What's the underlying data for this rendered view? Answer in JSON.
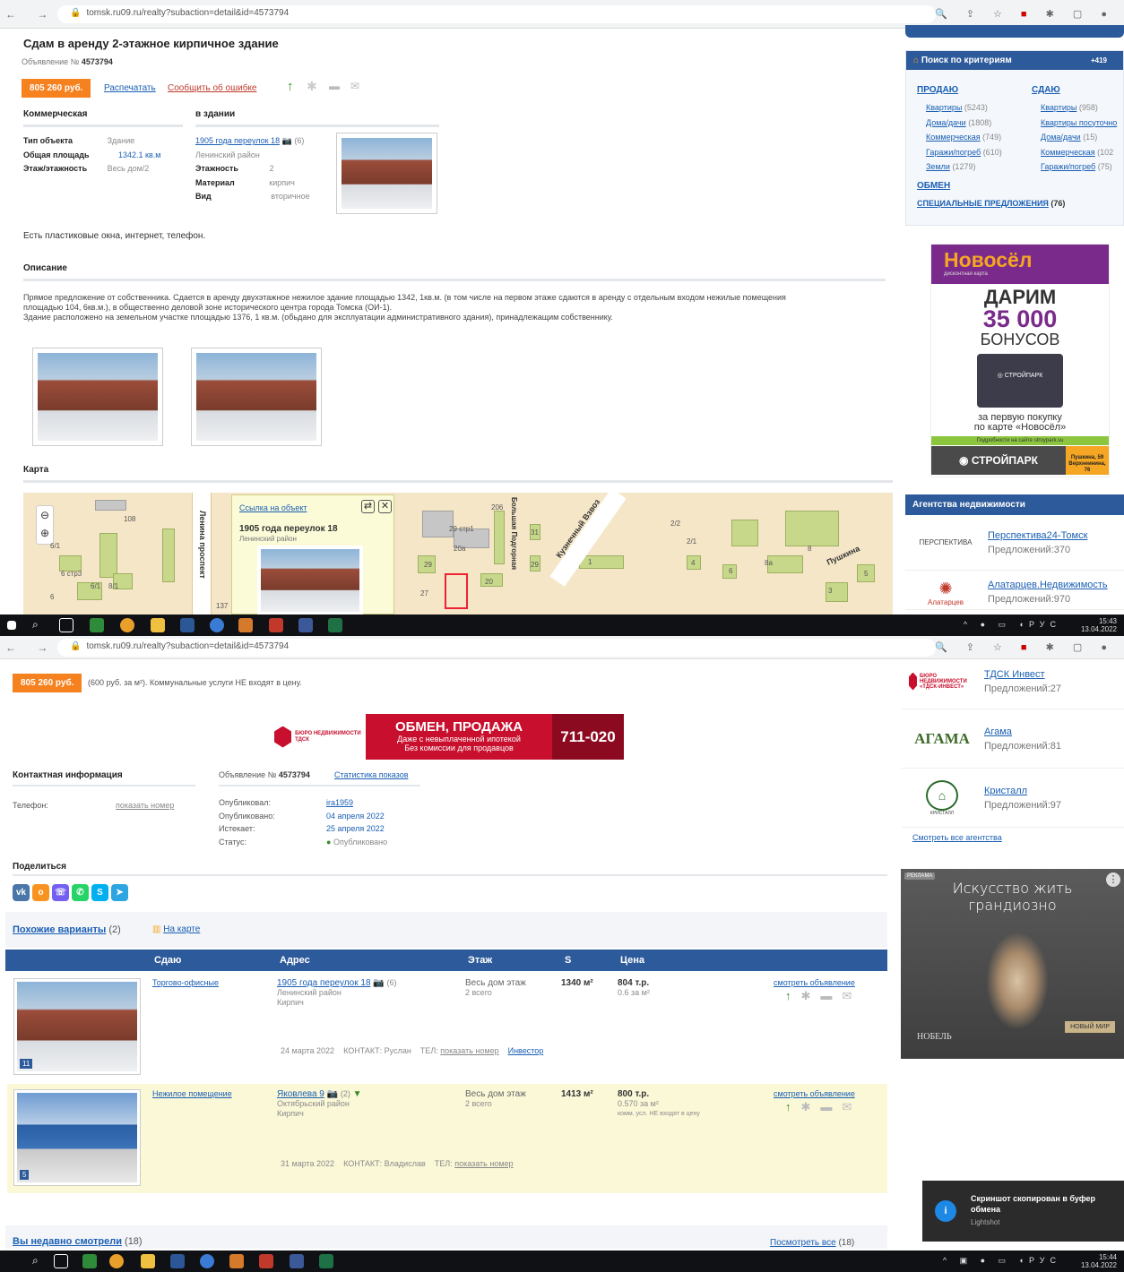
{
  "browser": {
    "url_top": "tomsk.ru09.ru/realty?subaction=detail&id=4573794",
    "url_bottom": "tomsk.ru09.ru/realty?subaction=detail&id=4573794",
    "nav": "← → C"
  },
  "listing": {
    "title": "Сдам в аренду 2-этажное кирпичное здание",
    "ad_number_label": "Объявление №",
    "ad_number": "4573794",
    "price": "805 260 руб.",
    "print": "Распечатать",
    "report": "Сообщить об ошибке",
    "section_commercial": "Коммерческая",
    "section_building": "в здании",
    "type_label": "Тип объекта",
    "type_value": "Здание",
    "area_label": "Общая площадь",
    "area_value": "1342.1 кв.м",
    "floor_label": "Этаж/этажность",
    "floor_value": "Весь дом/2",
    "address": "1905 года переулок 18",
    "address_count": "(6)",
    "district": "Ленинский район",
    "floors_label": "Этажность",
    "floors_value": "2",
    "material_label": "Материал",
    "material_value": "кирпич",
    "view_label": "Вид",
    "view_value": "вторичное",
    "features": "Есть пластиковые окна, интернет, телефон.",
    "desc_heading": "Описание",
    "desc_1": "Прямое предложение от собственника. Сдается в аренду двухэтажное нежилое здание площадью 1342, 1кв.м. (в том числе на первом этаже сдаются в аренду с отдельным входом нежилые помещения",
    "desc_2": "площадью 104, 6кв.м.), в общественно деловой зоне исторического центра города Томска (ОИ-1).",
    "desc_3": "Здание расположено на земельном участке площадью 1376, 1 кв.м. (обьдано для эксплуатации административного здания), принадлежащим собственнику.",
    "map_heading": "Карта"
  },
  "map": {
    "popup_link": "Ссылка на объект",
    "popup_address": "1905 года переулок 18",
    "popup_district": "Ленинский район",
    "street_1": "Ленина проспект",
    "street_2": "Кузнечный Взвоз",
    "street_3": "Пушкина",
    "street_4": "Большая Подгорная",
    "labels": [
      "108",
      "6/1",
      "6 стр3",
      "6/1",
      "8/1",
      "6",
      "29 стр1",
      "20a",
      "29",
      "27",
      "20",
      "31",
      "29",
      "206",
      "1",
      "2/2",
      "2/1",
      "4",
      "6",
      "8a",
      "8",
      "3",
      "5",
      "137"
    ]
  },
  "sidebar_top": {
    "search_heading": "Поиск по критериям",
    "search_count": "+419",
    "sell_heading": "ПРОДАЮ",
    "rent_heading": "СДАЮ",
    "sell_items": [
      {
        "label": "Квартиры",
        "count": "(5243)"
      },
      {
        "label": "Дома/дачи",
        "count": "(1808)"
      },
      {
        "label": "Коммерческая",
        "count": "(749)"
      },
      {
        "label": "Гаражи/погреб",
        "count": "(610)"
      },
      {
        "label": "Земли",
        "count": "(1279)"
      }
    ],
    "rent_items": [
      {
        "label": "Квартиры",
        "count": "(958)"
      },
      {
        "label": "Квартиры посуточно",
        "count": ""
      },
      {
        "label": "Дома/дачи",
        "count": "(15)"
      },
      {
        "label": "Коммерческая",
        "count": "(102"
      },
      {
        "label": "Гаражи/погреб",
        "count": "(75)"
      }
    ],
    "exchange": "ОБМЕН",
    "special": "СПЕЦИАЛЬНЫЕ ПРЕДЛОЖЕНИЯ",
    "special_count": "(76)"
  },
  "ad_novosel": {
    "brand": "Новосёл",
    "sub": "дисконтная карта",
    "line1": "ДАРИМ",
    "line2": "35 000",
    "line3": "БОНУСОВ",
    "line4": "за первую покупку",
    "line5": "по карте «Новосёл»",
    "line6": "Подробности на сайте stroypark.su",
    "shop": "СТРОЙПАРК",
    "addr": "Пушкина, 59 Верхнеинина, 76"
  },
  "agencies": {
    "heading": "Агентства недвижимости",
    "offers_label": "Предложений:",
    "list": [
      {
        "name": "Перспектива24-Томск",
        "count": "370",
        "logo": "ПЕРСПЕКТИВА"
      },
      {
        "name": "Алатарцев.Недвижимость",
        "count": "970",
        "logo": "Алатарцев"
      },
      {
        "name": "ТДСК Инвест",
        "count": "27",
        "logo": "БЮРО НЕДВИЖИМОСТИ «ТДСК-ИНВЕСТ»"
      },
      {
        "name": "Агама",
        "count": "81",
        "logo": "АГАМА"
      },
      {
        "name": "Кристалл",
        "count": "97",
        "logo": "КРИСТАЛЛ"
      }
    ],
    "see_all": "Смотреть все агентства"
  },
  "bottom": {
    "price": "805 260 руб.",
    "price_note": "(600 руб. за м²). Коммунальные услуги НЕ входят в цену.",
    "banner_logo": "БЮРО НЕДВИЖИМОСТИ ТДСК",
    "banner_title": "ОБМЕН, ПРОДАЖА",
    "banner_sub1": "Даже с невыплаченной ипотекой",
    "banner_sub2": "Без комиссии для продавцов",
    "banner_phone": "711-020",
    "contact_heading": "Контактная информация",
    "ad_label": "Объявление №",
    "ad_number": "4573794",
    "stats": "Статистика показов",
    "phone_label": "Телефон:",
    "phone_link": "показать номер",
    "published_by_label": "Опубликовал:",
    "published_by": "ira1959",
    "published_label": "Опубликовано:",
    "published": "04 апреля 2022",
    "expires_label": "Истекает:",
    "expires": "25 апреля 2022",
    "status_label": "Статус:",
    "status": "Опубликовано",
    "share_heading": "Поделиться",
    "similar": "Похожие варианты",
    "similar_count": "(2)",
    "on_map": "На карте",
    "cols": [
      "Сдаю",
      "Адрес",
      "Этаж",
      "S",
      "Цена"
    ],
    "rows": [
      {
        "type": "Торгово-офисные",
        "address": "1905 года переулок 18",
        "addr_count": "(6)",
        "district": "Ленинский район",
        "material": "Кирпич",
        "floor": "Весь дом этаж",
        "floor_total": "2 всего",
        "area": "1340 м²",
        "price": "804 т.р.",
        "price_sub": "0.6 за м²",
        "price_sub2": "",
        "view": "смотреть объявление",
        "date": "24 марта 2022",
        "contact": "КОНТАКТ: Руслан",
        "tel_label": "ТЕЛ:",
        "tel": "показать номер",
        "agency": "Инвестор",
        "photos": "11"
      },
      {
        "type": "Нежилое помещение",
        "address": "Яковлева 9",
        "addr_count": "(2)",
        "district": "Октябрьский район",
        "material": "Кирпич",
        "floor": "Весь дом этаж",
        "floor_total": "2 всего",
        "area": "1413 м²",
        "price": "800 т.р.",
        "price_sub": "0.570 за м²",
        "price_sub2": "комм. усл. НЕ входят в цену",
        "view": "смотреть объявление",
        "date": "31 марта 2022",
        "contact": "КОНТАКТ: Владислав",
        "tel_label": "ТЕЛ:",
        "tel": "показать номер",
        "agency": "",
        "photos": "5"
      }
    ],
    "recent": "Вы недавно смотрели",
    "recent_count": "(18)",
    "see_all": "Посмотреть все",
    "see_all_count": "(18)"
  },
  "ad_art": {
    "badge": "РЕКЛАМА",
    "line1": "Искусство жить",
    "line2": "грандиозно",
    "brand": "НОБЕЛЬ",
    "brand2": "НОВЫЙ МИР"
  },
  "toast": {
    "title": "Скриншот скопирован в буфер обмена",
    "app": "Lightshot"
  },
  "taskbar": {
    "lang": "РУС",
    "time_top": "15:43",
    "date_top": "13.04.2022",
    "time_bottom": "15:44",
    "date_bottom": "13.04.2022"
  }
}
